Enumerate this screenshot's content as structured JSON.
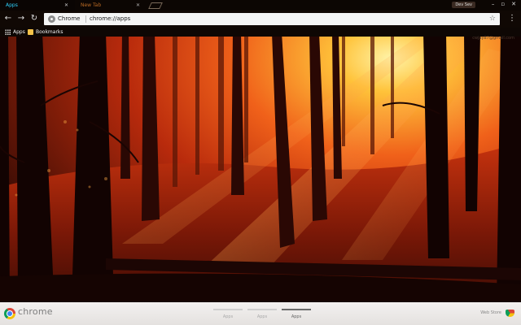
{
  "tabs": [
    {
      "label": "Apps",
      "active": true
    },
    {
      "label": "New Tab",
      "active": false
    }
  ],
  "window": {
    "profile_label": "Dev Sev",
    "minimize_icon": "minimize-icon",
    "restore_icon": "restore-icon",
    "close_icon": "close-icon"
  },
  "toolbar": {
    "omnibox_scheme": "Chrome",
    "omnibox_url": "chrome://apps"
  },
  "bookmarks": {
    "apps_label": "Apps",
    "bookmarks_label": "Bookmarks"
  },
  "account": {
    "email": "cwjay87@gmail.com"
  },
  "bottom_bar": {
    "wordmark": "chrome",
    "pages": [
      {
        "label": "Apps",
        "active": false
      },
      {
        "label": "Apps",
        "active": false
      },
      {
        "label": "Apps",
        "active": true
      }
    ],
    "web_store_label": "Web Store"
  },
  "theme_colors": {
    "active_tab_text": "#2fd3ff",
    "inactive_tab_text": "#d87b2a",
    "scene_glow": "#ffb02a"
  }
}
